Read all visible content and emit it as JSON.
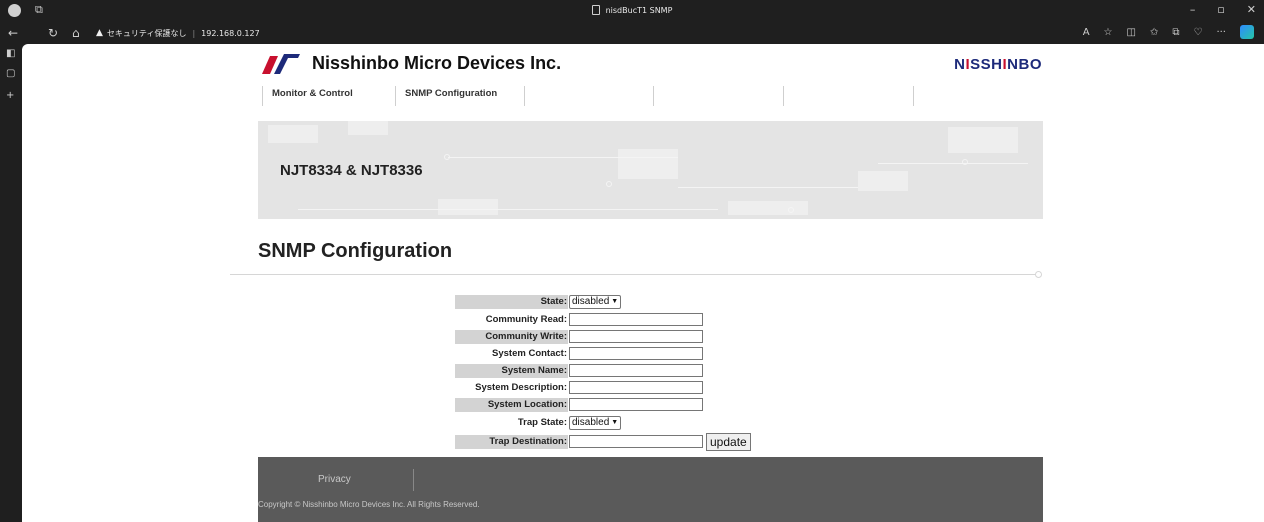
{
  "browser": {
    "window_title": "nisdBucT1 SNMP",
    "security_label": "セキュリティ保護なし",
    "address": "192.168.0.127"
  },
  "site": {
    "brand": "Nisshinbo Micro Devices Inc.",
    "brand_right_prefix": "N",
    "brand_right_i1": "I",
    "brand_right_mid": "SSH",
    "brand_right_i2": "I",
    "brand_right_suffix": "NBO",
    "menu": [
      {
        "label": "Monitor & Control"
      },
      {
        "label": "SNMP Configuration"
      },
      {
        "label": ""
      },
      {
        "label": ""
      },
      {
        "label": ""
      }
    ],
    "banner_title": "NJT8334 & NJT8336",
    "page_title": "SNMP Configuration"
  },
  "form": {
    "state_label": "State:",
    "state_value": "disabled",
    "community_read_label": "Community Read:",
    "community_write_label": "Community Write:",
    "system_contact_label": "System Contact:",
    "system_name_label": "System Name:",
    "system_description_label": "System Description:",
    "system_location_label": "System Location:",
    "trap_state_label": "Trap State:",
    "trap_state_value": "disabled",
    "trap_destination_label": "Trap Destination:",
    "update_label": "update"
  },
  "footer": {
    "privacy": "Privacy",
    "copyright": "Copyright © Nisshinbo Micro Devices Inc. All Rights Reserved."
  }
}
